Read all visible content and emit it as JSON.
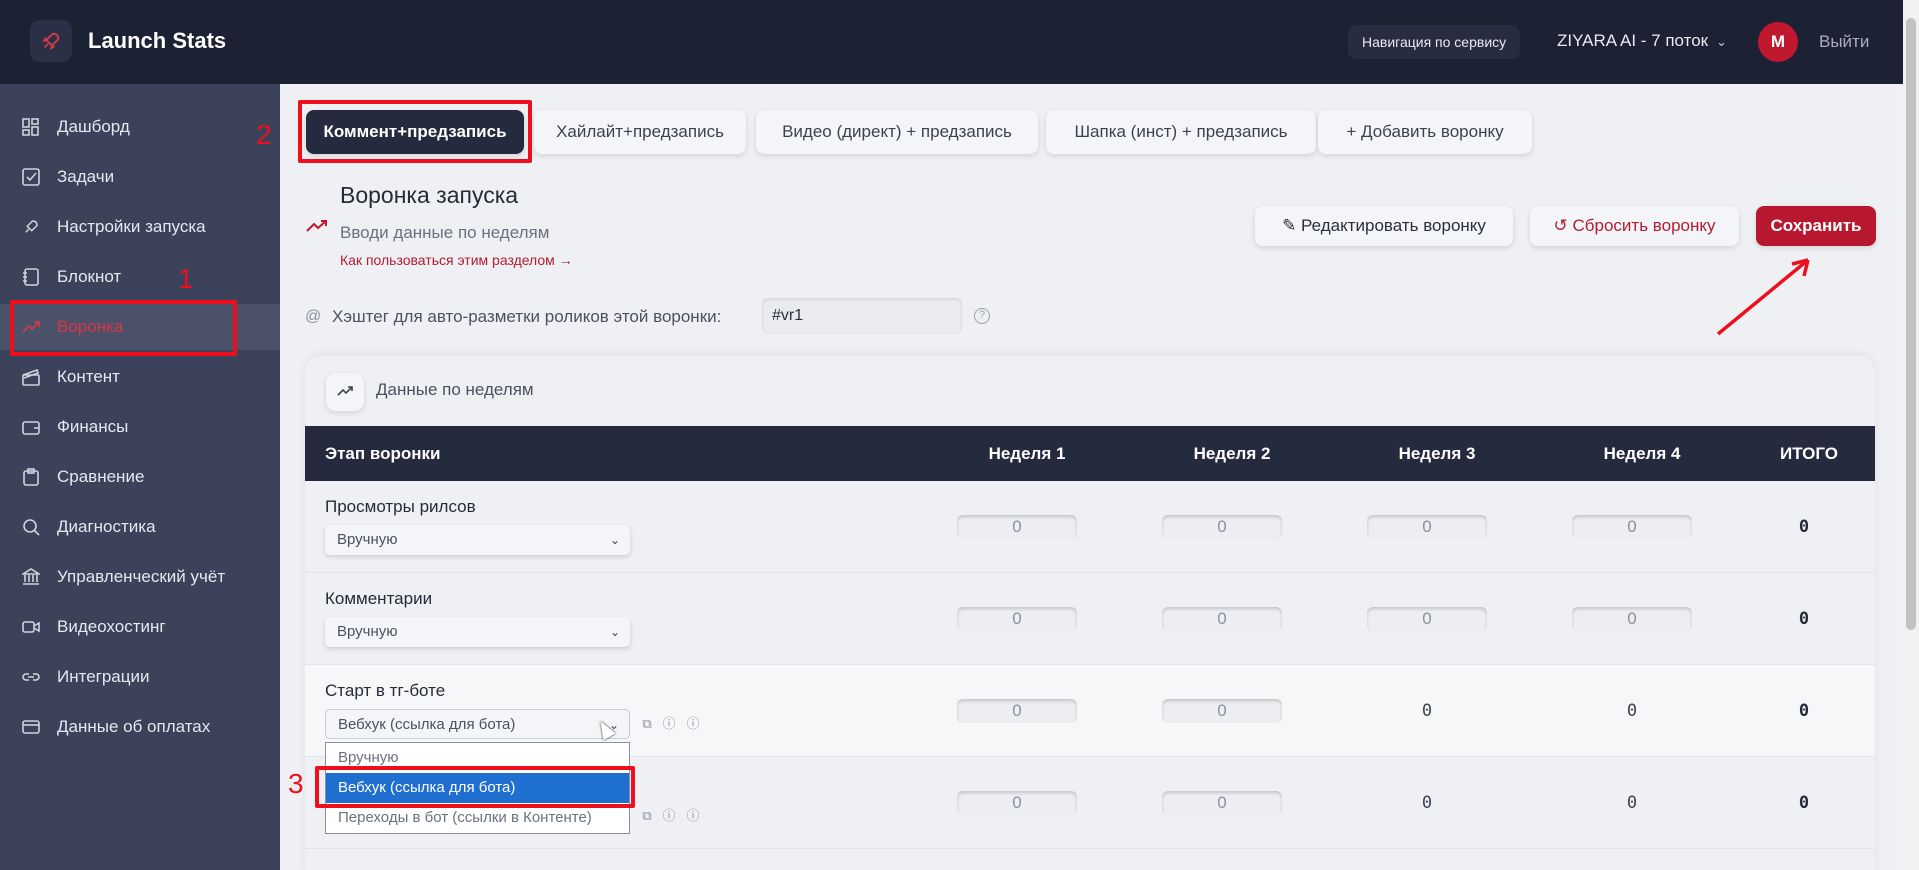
{
  "header": {
    "app_title": "Launch Stats",
    "nav_help_label": "Навигация по сервису",
    "project_label": "ZIYARA AI - 7 поток",
    "avatar_letter": "M",
    "logout_label": "Выйти"
  },
  "sidebar": {
    "items": [
      {
        "label": "Дашборд",
        "icon": "dashboard-icon"
      },
      {
        "label": "Задачи",
        "icon": "checkbox-icon"
      },
      {
        "label": "Настройки запуска",
        "icon": "rocket-icon"
      },
      {
        "label": "Блокнот",
        "icon": "notebook-icon"
      },
      {
        "label": "Воронка",
        "icon": "trend-icon",
        "active": true
      },
      {
        "label": "Контент",
        "icon": "clapper-icon"
      },
      {
        "label": "Финансы",
        "icon": "wallet-icon"
      },
      {
        "label": "Сравнение",
        "icon": "clipboard-icon"
      },
      {
        "label": "Диагностика",
        "icon": "search-icon"
      },
      {
        "label": "Управленческий учёт",
        "icon": "bank-icon"
      },
      {
        "label": "Видеохостинг",
        "icon": "video-icon"
      },
      {
        "label": "Интеграции",
        "icon": "link-icon"
      },
      {
        "label": "Данные об оплатах",
        "icon": "card-icon"
      }
    ]
  },
  "tabs": [
    {
      "label": "Коммент+предзапись",
      "active": true
    },
    {
      "label": "Хайлайт+предзапись"
    },
    {
      "label": "Видео (директ) + предзапись"
    },
    {
      "label": "Шапка (инст) + предзапись"
    },
    {
      "label": "+ Добавить воронку"
    }
  ],
  "section": {
    "title": "Воронка запуска",
    "subtitle": "Вводи данные по неделям",
    "help_link": "Как пользоваться этим разделом →",
    "edit_button": "Редактировать воронку",
    "reset_button": "Сбросить воронку",
    "save_button": "Сохранить"
  },
  "hashtag": {
    "at_symbol": "@",
    "label": "Хэштег для авто-разметки роликов этой воронки:",
    "value": "#vr1",
    "help": "?"
  },
  "weekly": {
    "title": "Данные по неделям",
    "columns": [
      "Этап воронки",
      "Неделя 1",
      "Неделя 2",
      "Неделя 3",
      "Неделя 4",
      "ИТОГО"
    ],
    "rows": [
      {
        "label": "Просмотры рилсов",
        "source": "Вручную",
        "values": [
          "0",
          "0",
          "0",
          "0"
        ],
        "total": "0"
      },
      {
        "label": "Комментарии",
        "source": "Вручную",
        "values": [
          "0",
          "0",
          "0",
          "0"
        ],
        "total": "0"
      },
      {
        "label": "Старт в тг-боте",
        "source": "Вебхук (ссылка для бота)",
        "values": [
          "0",
          "0",
          "0",
          "0"
        ],
        "total": "0"
      },
      {
        "label": "",
        "source": "",
        "values": [
          "0",
          "0",
          "0",
          "0"
        ],
        "total": "0"
      }
    ],
    "dropdown_options": [
      "Вручную",
      "Вебхук (ссылка для бота)",
      "Переходы в бот (ссылки в Контенте)"
    ]
  },
  "annotations": [
    "1",
    "2",
    "3"
  ],
  "colors": {
    "accent": "#c0182f",
    "sidebar_bg": "#3b4259",
    "topbar_bg": "#1d2134",
    "table_header_bg": "#252a3f",
    "annotation": "#ef0e1e"
  }
}
